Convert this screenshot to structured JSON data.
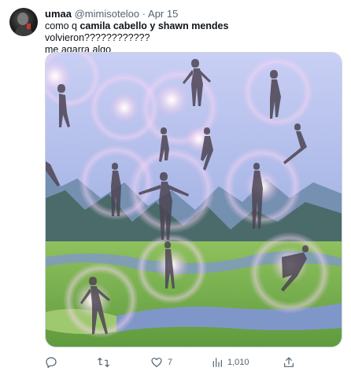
{
  "author": {
    "display_name": "umaa",
    "handle": "@mimisoteloo",
    "separator": "·",
    "date": "Apr 15"
  },
  "tweet": {
    "line1_prefix": "como q ",
    "line1_bold": "camila cabello y shawn mendes",
    "line1_suffix": " volvieron????????????",
    "line2": "me agarra algo"
  },
  "media": {
    "description_icon": "image",
    "sky_color": "#a9b7e6",
    "mountain_color": "#4a6b6a",
    "grass_color": "#6fa84a",
    "water_color": "#7f97c8"
  },
  "actions": {
    "reply_icon": "reply-icon",
    "retweet_icon": "retweet-icon",
    "like_icon": "heart-icon",
    "like_count": "7",
    "views_icon": "views-icon",
    "views_count": "1,010",
    "share_icon": "share-icon"
  }
}
